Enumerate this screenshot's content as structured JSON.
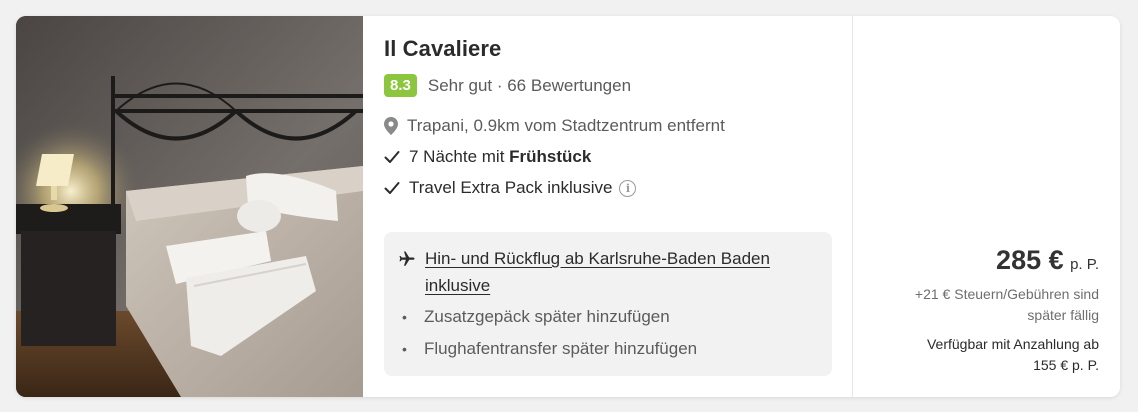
{
  "hotel": {
    "name": "Il Cavaliere",
    "score": "8.3",
    "rating_text": "Sehr gut · 66 Bewertungen",
    "location": "Trapani, 0.9km vom Stadtzentrum entfernt"
  },
  "features": {
    "nights_prefix": "7 Nächte mit ",
    "nights_bold": "Frühstück",
    "pack": "Travel Extra Pack inklusive"
  },
  "flight": {
    "link_line1": "Hin- und Rückflug ab Karlsruhe-Baden Baden",
    "link_line2": "inklusive",
    "sub_items": [
      "Zusatzgepäck später hinzufügen",
      "Flughafentransfer später hinzufügen"
    ]
  },
  "price": {
    "amount": "285 €",
    "per": "p. P.",
    "tax_line1": "+21 € Steuern/Gebühren sind",
    "tax_line2": "später fällig",
    "deposit_line1": "Verfügbar mit Anzahlung ab",
    "deposit_line2": "155 € p. P."
  },
  "icons": {
    "location": "map-pin-icon",
    "check": "check-icon",
    "info": "info-icon",
    "plane": "plane-icon"
  },
  "colors": {
    "score_badge": "#8cc63e",
    "card_bg": "#ffffff",
    "flight_box_bg": "#f2f2f3",
    "page_bg": "#f1f1f2"
  }
}
